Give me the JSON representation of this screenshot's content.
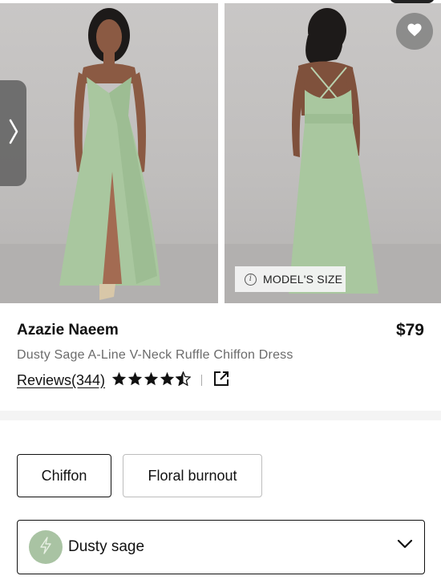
{
  "product": {
    "brand": "Azazie Naeem",
    "price": "$79",
    "subtitle": "Dusty Sage A-Line V-Neck Ruffle Chiffon Dress",
    "reviews_label": "Reviews(344)",
    "rating": 4.5,
    "rating_max": 5
  },
  "gallery": {
    "model_size_label": "MODEL'S SIZE",
    "icons": {
      "prev": "chevron-right-icon",
      "favorite": "heart-icon",
      "info": "info-icon",
      "external": "external-link-icon"
    }
  },
  "fabric_options": [
    {
      "label": "Chiffon",
      "selected": true
    },
    {
      "label": "Floral burnout",
      "selected": false
    }
  ],
  "color_select": {
    "value": "Dusty sage",
    "swatch_color": "#a9c3a3"
  },
  "colors": {
    "dress": "#a9c79f",
    "text": "#111111",
    "muted": "#6b6b6b"
  }
}
